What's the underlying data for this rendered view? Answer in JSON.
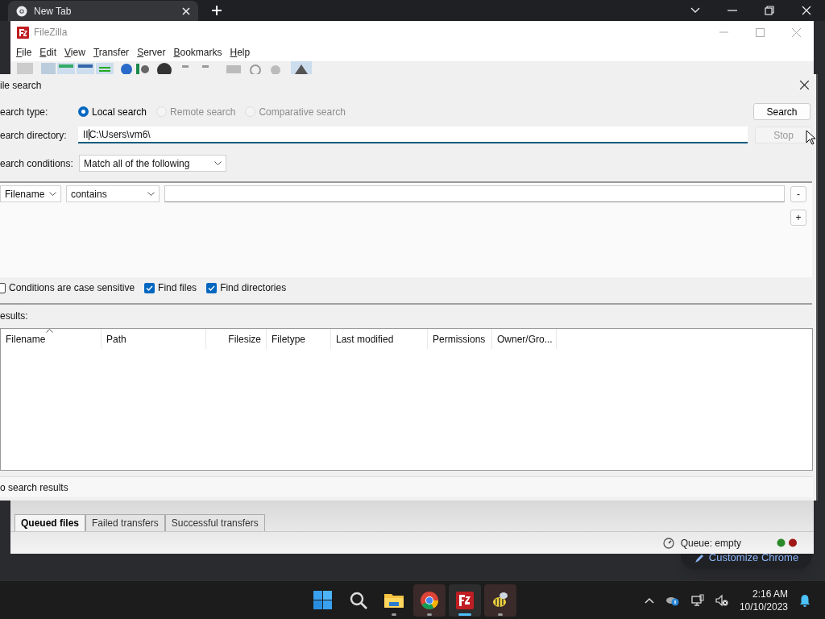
{
  "browser": {
    "tab": {
      "title": "New Tab"
    },
    "customize_button": "Customize Chrome"
  },
  "filezilla": {
    "title": "FileZilla",
    "menu": [
      "File",
      "Edit",
      "View",
      "Transfer",
      "Server",
      "Bookmarks",
      "Help"
    ],
    "queue_tabs": [
      {
        "label": "Queued files",
        "selected": true
      },
      {
        "label": "Failed transfers",
        "selected": false
      },
      {
        "label": "Successful transfers",
        "selected": false
      }
    ],
    "status": "Queue: empty"
  },
  "dialog": {
    "title": "ile search",
    "search_type": {
      "label": "earch type:",
      "options": [
        {
          "label": "Local search",
          "selected": true,
          "disabled": false
        },
        {
          "label": "Remote search",
          "selected": false,
          "disabled": true
        },
        {
          "label": "Comparative search",
          "selected": false,
          "disabled": true
        }
      ]
    },
    "directory": {
      "label": "earch directory:",
      "value": "IIC:\\Users\\vm6\\"
    },
    "conditions": {
      "label": "earch conditions:",
      "value": "Match all of the following"
    },
    "buttons": [
      {
        "label": "Search",
        "disabled": false
      },
      {
        "label": "Stop",
        "disabled": true
      }
    ],
    "condition_rows": [
      {
        "field": "Filename",
        "operator": "contains"
      }
    ],
    "remove_button": "-",
    "add_button": "+",
    "options": [
      {
        "label": "Conditions are case sensitive",
        "checked": false
      },
      {
        "label": "Find files",
        "checked": true
      },
      {
        "label": "Find directories",
        "checked": true
      }
    ],
    "results_label": "esults:",
    "table": {
      "columns": [
        {
          "label": "Filename",
          "sorted": true
        },
        {
          "label": "Path",
          "sorted": false
        },
        {
          "label": "Filesize",
          "sorted": false
        },
        {
          "label": "Filetype",
          "sorted": false
        },
        {
          "label": "Last modified",
          "sorted": false
        },
        {
          "label": "Permissions",
          "sorted": false
        },
        {
          "label": "Owner/Gro...",
          "sorted": false
        }
      ]
    },
    "status": "o search results"
  },
  "taskbar": {
    "apps": [
      {
        "kind": "start",
        "active": false,
        "open": false
      },
      {
        "kind": "search",
        "active": false,
        "open": false
      },
      {
        "kind": "explorer",
        "active": false,
        "open": true
      },
      {
        "kind": "chrome",
        "active": false,
        "open": true
      },
      {
        "kind": "filezilla",
        "active": true,
        "open": true
      },
      {
        "kind": "bee",
        "active": false,
        "open": true
      }
    ],
    "time": "2:16 AM",
    "date": "10/10/2023"
  }
}
